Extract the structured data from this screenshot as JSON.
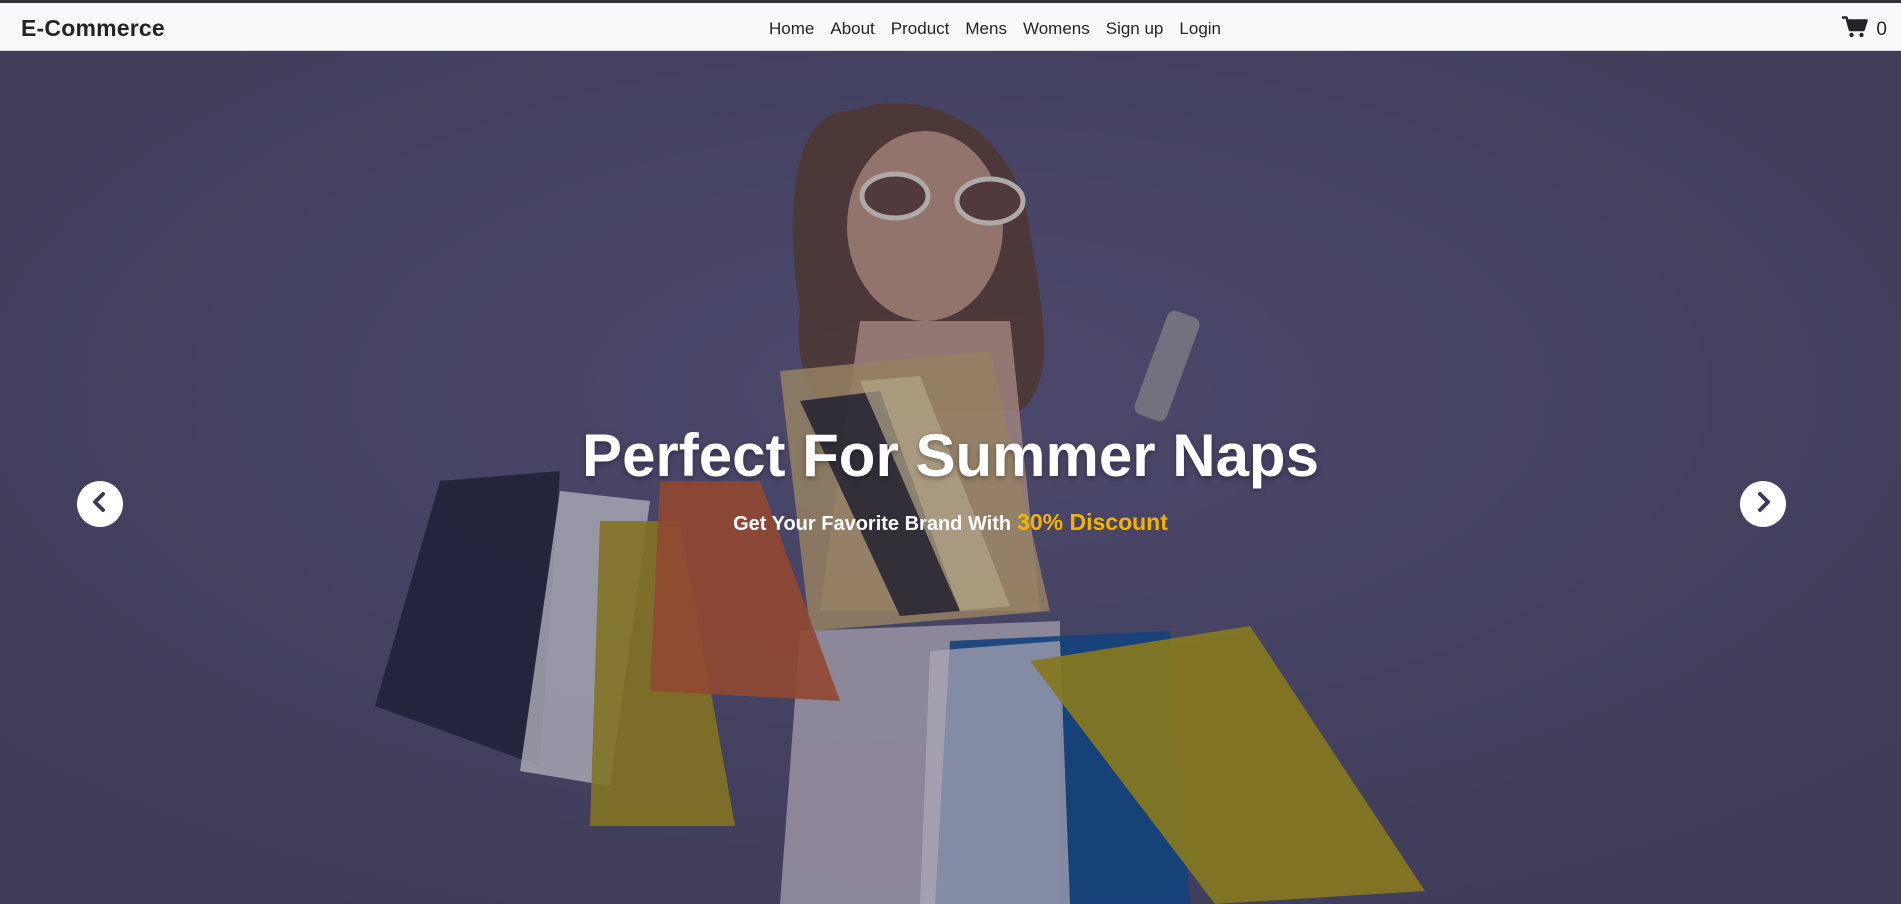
{
  "navbar": {
    "brand": "E-Commerce",
    "links": [
      "Home",
      "About",
      "Product",
      "Mens",
      "Womens",
      "Sign up",
      "Login"
    ],
    "cart_count": "0"
  },
  "hero": {
    "title": "Perfect For Summer Naps",
    "subtitle_prefix": "Get Your Favorite Brand With",
    "subtitle_highlight": "30% Discount"
  },
  "colors": {
    "navbar_bg": "#f8f9fa",
    "hero_bg": "#4b486a",
    "highlight": "#f5b301",
    "text_dark": "#212529"
  },
  "icons": {
    "cart": "shopping-cart-icon",
    "prev": "chevron-left-icon",
    "next": "chevron-right-icon"
  }
}
